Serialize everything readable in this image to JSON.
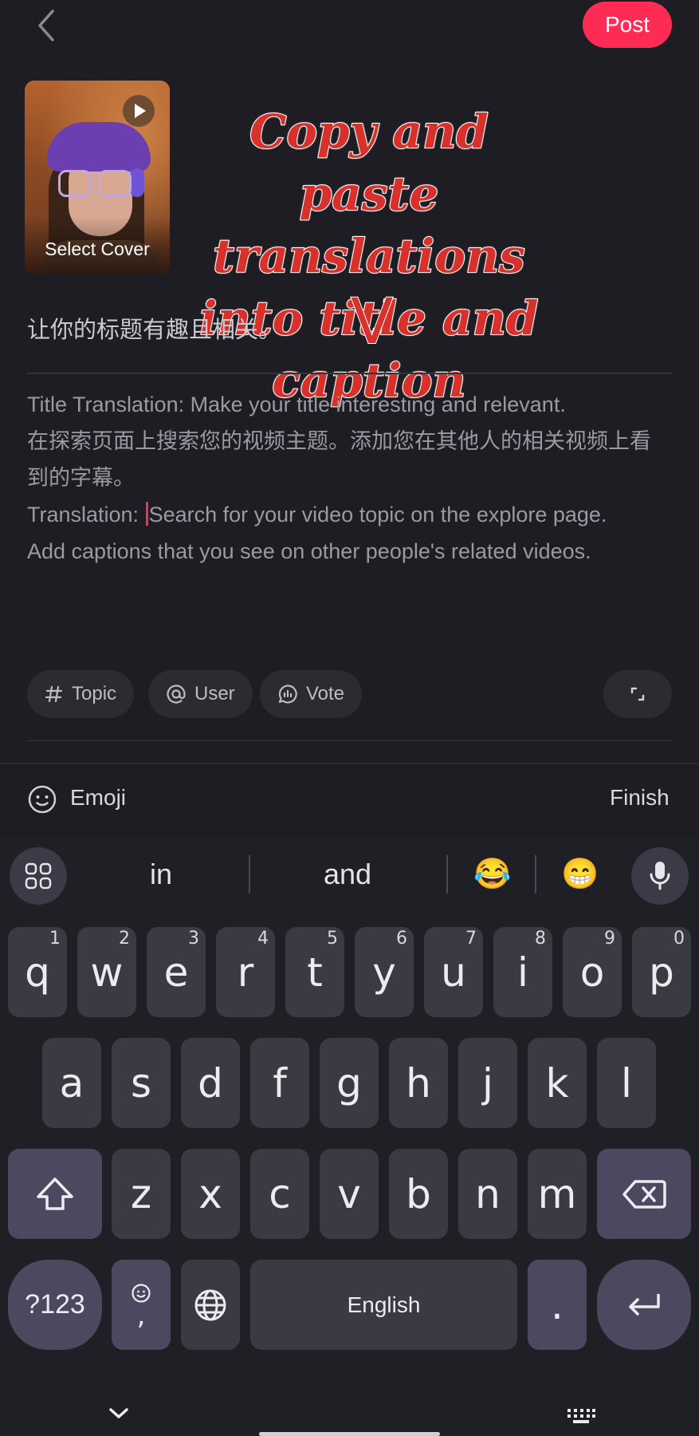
{
  "header": {
    "post_label": "Post"
  },
  "cover": {
    "label": "Select Cover"
  },
  "annotation": {
    "text": "Copy and paste translations into title and caption",
    "arrow": "V"
  },
  "title_field": {
    "value": "让你的标题有趣且相关。"
  },
  "caption_field": {
    "line1": "Title Translation: Make your title interesting and relevant.",
    "line2": "在探索页面上搜索您的视频主题。添加您在其他人的相关视频上看到的字幕。",
    "line3_before_cursor": "Translation: ",
    "line3_after_cursor": "Search for your video topic on the explore page.",
    "line4": "Add captions that you see on other people's related videos."
  },
  "chips": {
    "topic": "Topic",
    "user": "User",
    "vote": "Vote"
  },
  "emoji_bar": {
    "emoji_label": "Emoji",
    "finish_label": "Finish"
  },
  "keyboard": {
    "suggestions": [
      "in",
      "and",
      "😂",
      "😁"
    ],
    "row1": [
      {
        "key": "q",
        "num": "1"
      },
      {
        "key": "w",
        "num": "2"
      },
      {
        "key": "e",
        "num": "3"
      },
      {
        "key": "r",
        "num": "4"
      },
      {
        "key": "t",
        "num": "5"
      },
      {
        "key": "y",
        "num": "6"
      },
      {
        "key": "u",
        "num": "7"
      },
      {
        "key": "i",
        "num": "8"
      },
      {
        "key": "o",
        "num": "9"
      },
      {
        "key": "p",
        "num": "0"
      }
    ],
    "row2": [
      "a",
      "s",
      "d",
      "f",
      "g",
      "h",
      "j",
      "k",
      "l"
    ],
    "row3": [
      "z",
      "x",
      "c",
      "v",
      "b",
      "n",
      "m"
    ],
    "symbols_label": "?123",
    "comma_label": ",",
    "space_label": "English",
    "period_label": "."
  },
  "colors": {
    "accent": "#fe2c55",
    "background": "#1d1d23",
    "key": "#3a3a42",
    "special_key": "#4c4860"
  },
  "icons": [
    "back-chevron-icon",
    "play-icon",
    "hash-icon",
    "at-icon",
    "vote-icon",
    "expand-icon",
    "smiley-icon",
    "apps-grid-icon",
    "mic-icon",
    "shift-icon",
    "backspace-icon",
    "emoji-key-icon",
    "globe-icon",
    "enter-icon",
    "hide-keyboard-icon",
    "keyboard-switch-icon"
  ]
}
